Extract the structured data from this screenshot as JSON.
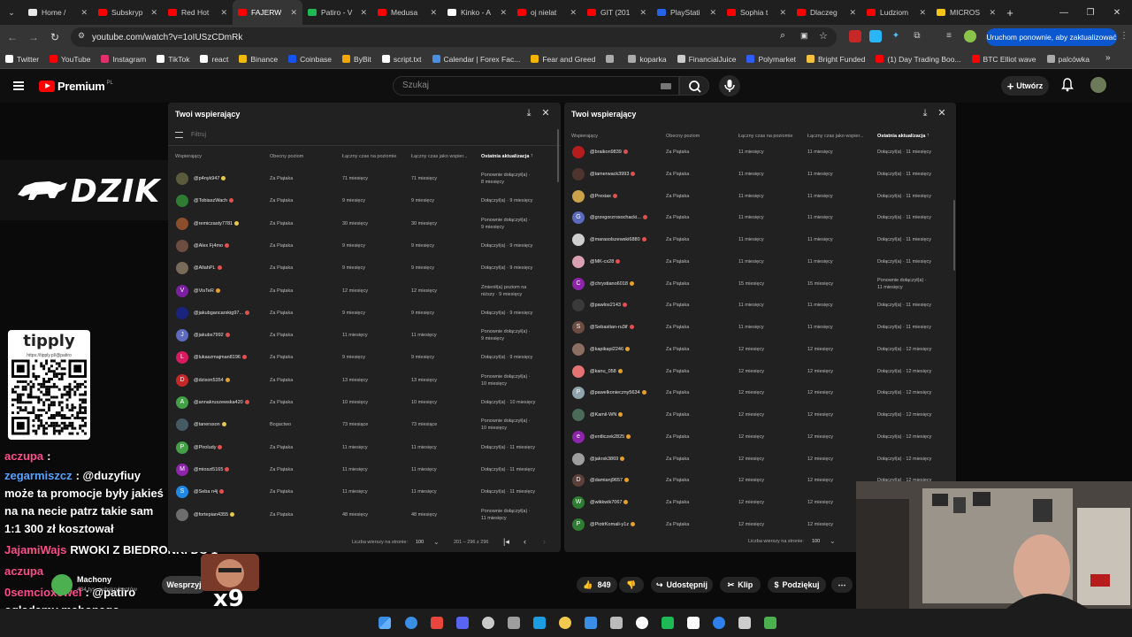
{
  "browser": {
    "tabs": [
      {
        "title": "Home /",
        "color": "#e8e8e8"
      },
      {
        "title": "Subskryp",
        "color": "#ff0000"
      },
      {
        "title": "Red Hot",
        "color": "#ff0000"
      },
      {
        "title": "FAJERW",
        "color": "#ff0000",
        "active": true
      },
      {
        "title": "Patiro - V",
        "color": "#1db954"
      },
      {
        "title": "Medusa",
        "color": "#ff0000"
      },
      {
        "title": "Kinko - A",
        "color": "#ffffff"
      },
      {
        "title": "oj nielat",
        "color": "#ff0000"
      },
      {
        "title": "GIT (201",
        "color": "#ff0000"
      },
      {
        "title": "PlayStati",
        "color": "#2563eb"
      },
      {
        "title": "Sophia t",
        "color": "#ff0000"
      },
      {
        "title": "Dlaczeg",
        "color": "#ff0000"
      },
      {
        "title": "Ludziom",
        "color": "#ff0000"
      },
      {
        "title": "MICROS",
        "color": "#f5c518"
      }
    ],
    "url": "youtube.com/watch?v=1oIUSzCDmRk",
    "update_label": "Uruchom ponownie, aby zaktualizować",
    "bookmarks": [
      {
        "label": "Twitter",
        "color": "#ffffff"
      },
      {
        "label": "YouTube",
        "color": "#ff0000"
      },
      {
        "label": "Instagram",
        "color": "#e1306c"
      },
      {
        "label": "TikTok",
        "color": "#ffffff"
      },
      {
        "label": "react",
        "color": "#ffffff"
      },
      {
        "label": "Binance",
        "color": "#f0b90b"
      },
      {
        "label": "Coinbase",
        "color": "#1652f0"
      },
      {
        "label": "ByBit",
        "color": "#f7a600"
      },
      {
        "label": "script.txt",
        "color": "#ffffff"
      },
      {
        "label": "Calendar | Forex Fac...",
        "color": "#4a90e2"
      },
      {
        "label": "Fear and Greed",
        "color": "#f4b400"
      },
      {
        "label": "",
        "color": "#aaaaaa"
      },
      {
        "label": "koparka",
        "color": "#aaaaaa"
      },
      {
        "label": "FinancialJuice",
        "color": "#cccccc"
      },
      {
        "label": "Polymarket",
        "color": "#2e5cff"
      },
      {
        "label": "Bright Funded",
        "color": "#f6c23e"
      },
      {
        "label": "(1) Day Trading Boo...",
        "color": "#ff0000"
      },
      {
        "label": "BTC Elliot wave",
        "color": "#ff0000"
      },
      {
        "label": "palcówka",
        "color": "#aaaaaa"
      }
    ]
  },
  "youtube": {
    "logo_text": "Premium",
    "logo_superscript": "PL",
    "search_placeholder": "Szukaj",
    "create_label": "Utwórz"
  },
  "video": {
    "brand": "DZIK",
    "tipply_title": "tipply",
    "tipply_url": "https://tipply.pl/@patiro",
    "chat": [
      {
        "user": "aczupa",
        "text": ":"
      },
      {
        "user": "zegarmiszcz",
        "text": ": @duzyfiuy"
      },
      {
        "user": "",
        "text": "może ta promocje były jakieś"
      },
      {
        "user": "",
        "text": "na na necie patrz takie sam"
      },
      {
        "user": "",
        "text": "1:1 300 zł kosztował"
      },
      {
        "user": "JajamiWajs",
        "text": "RWOKI Z BIEDRONKI DO 1"
      },
      {
        "user": "aczupa",
        "text": ""
      },
      {
        "user": "0semcioxcwel",
        "text": ": @patiro"
      },
      {
        "user": "",
        "text": "ogladamy mahonego"
      }
    ],
    "channel_name": "Machony",
    "channel_subs": "434 tys. subskrybentów",
    "support_label": "Wesprzyj",
    "meme_text": "x9",
    "likes": "849",
    "share_label": "Udostępnij",
    "clip_label": "Klip",
    "thanks_label": "Podziękuj"
  },
  "panel_left": {
    "title": "Twoi wspierający",
    "filter_placeholder": "Filtruj",
    "headers": [
      "Wspierający",
      "Obecny poziom",
      "Łączny czas na poziomie",
      "Łączny czas jako wspier...",
      "Ostatnia aktualizacja"
    ],
    "rows": [
      {
        "name": "@p4nyk947",
        "level": "Za Piątaka",
        "t1": "71 miesięcy",
        "t2": "71 miesięcy",
        "upd1": "Ponownie dołączył(a) ·",
        "upd2": "8 miesięcy",
        "av": "#5a5a3c",
        "badge": "#e6c84b"
      },
      {
        "name": "@TobiaszWach",
        "level": "Za Piątaka",
        "t1": "9 miesięcy",
        "t2": "9 miesięcy",
        "upd1": "Dołączył(a) · 9 miesięcy",
        "upd2": "",
        "av": "#2e7d32",
        "badge": "#e05050"
      },
      {
        "name": "@remiczasty7781",
        "level": "Za Piątaka",
        "t1": "30 miesięcy",
        "t2": "30 miesięcy",
        "upd1": "Ponownie dołączył(a) ·",
        "upd2": "9 miesięcy",
        "av": "#8d4f2b",
        "badge": "#e6c84b"
      },
      {
        "name": "@Alex Fj4mo",
        "level": "Za Piątaka",
        "t1": "9 miesięcy",
        "t2": "9 miesięcy",
        "upd1": "Dołączył(a) · 9 miesięcy",
        "upd2": "",
        "av": "#6d4c41",
        "badge": "#e05050"
      },
      {
        "name": "@AllahPL",
        "level": "Za Piątaka",
        "t1": "9 miesięcy",
        "t2": "9 miesięcy",
        "upd1": "Dołączył(a) · 9 miesięcy",
        "upd2": "",
        "av": "#7a6a5a",
        "badge": "#e05050"
      },
      {
        "name": "@VisTeR",
        "level": "Za Piątaka",
        "t1": "12 miesięcy",
        "t2": "12 miesięcy",
        "upd1": "Zmienił(a) poziom na",
        "upd2": "niższy · 9 miesięcy",
        "av": "#7b1fa2",
        "initial": "V",
        "badge": "#e6a02b"
      },
      {
        "name": "@jakubgancarskig97...",
        "level": "Za Piątaka",
        "t1": "9 miesięcy",
        "t2": "9 miesięcy",
        "upd1": "Dołączył(a) · 9 miesięcy",
        "upd2": "",
        "av": "#1a237e",
        "badge": "#e05050"
      },
      {
        "name": "@jakubs7992",
        "level": "Za Piątaka",
        "t1": "11 miesięcy",
        "t2": "11 miesięcy",
        "upd1": "Ponownie dołączył(a) ·",
        "upd2": "9 miesięcy",
        "av": "#5c6bc0",
        "initial": "J",
        "badge": "#e05050"
      },
      {
        "name": "@lukaszmajman8196",
        "level": "Za Piątaka",
        "t1": "9 miesięcy",
        "t2": "9 miesięcy",
        "upd1": "Dołączył(a) · 9 miesięcy",
        "upd2": "",
        "av": "#d81b60",
        "initial": "L",
        "badge": "#e05050"
      },
      {
        "name": "@dzixon5354",
        "level": "Za Piątaka",
        "t1": "13 miesięcy",
        "t2": "13 miesięcy",
        "upd1": "Ponownie dołączył(a) ·",
        "upd2": "10 miesięcy",
        "av": "#c62828",
        "initial": "D",
        "badge": "#e6a02b"
      },
      {
        "name": "@annakruszewska420",
        "level": "Za Piątaka",
        "t1": "10 miesięcy",
        "t2": "10 miesięcy",
        "upd1": "Dołączył(a) · 10 miesięcy",
        "upd2": "",
        "av": "#43a047",
        "initial": "A",
        "badge": "#e05050"
      },
      {
        "name": "@tanersson",
        "level": "Bogactwo",
        "t1": "73 miesiące",
        "t2": "73 miesiące",
        "upd1": "Ponownie dołączył(a) ·",
        "upd2": "10 miesięcy",
        "av": "#455a64",
        "badge": "#e6c84b"
      },
      {
        "name": "@Piroludy",
        "level": "Za Piątaka",
        "t1": "11 miesięcy",
        "t2": "11 miesięcy",
        "upd1": "Dołączył(a) · 11 miesięcy",
        "upd2": "",
        "av": "#43a047",
        "initial": "P",
        "badge": "#e05050"
      },
      {
        "name": "@mioszi5165",
        "level": "Za Piątaka",
        "t1": "11 miesięcy",
        "t2": "11 miesięcy",
        "upd1": "Dołączył(a) · 11 miesięcy",
        "upd2": "",
        "av": "#8e24aa",
        "initial": "M",
        "badge": "#e05050"
      },
      {
        "name": "@Seba n4j",
        "level": "Za Piątaka",
        "t1": "11 miesięcy",
        "t2": "11 miesięcy",
        "upd1": "Dołączył(a) · 11 miesięcy",
        "upd2": "",
        "av": "#1e88e5",
        "initial": "S",
        "badge": "#e05050"
      },
      {
        "name": "@fortepian4355",
        "level": "Za Piątaka",
        "t1": "48 miesięcy",
        "t2": "48 miesięcy",
        "upd1": "Ponownie dołączył(a) ·",
        "upd2": "11 miesięcy",
        "av": "#6d6d6d",
        "badge": "#e6c84b"
      }
    ],
    "rows_per_page_label": "Liczba wierszy na stronie:",
    "rows_per_page": "100",
    "range": "201 – 296 z 296"
  },
  "panel_right": {
    "title": "Twoi wspierający",
    "headers": [
      "Wspierający",
      "Obecny poziom",
      "Łączny czas na poziomie",
      "Łączny czas jako wspier...",
      "Ostatnia aktualizacja"
    ],
    "rows": [
      {
        "name": "@braikon9839",
        "level": "Za Piątaka",
        "t1": "11 miesięcy",
        "t2": "11 miesięcy",
        "upd1": "Dołączył(a) · 11 miesięcy",
        "upd2": "",
        "av": "#b71c1c",
        "badge": "#e05050"
      },
      {
        "name": "@tamerwack3993",
        "level": "Za Piątaka",
        "t1": "11 miesięcy",
        "t2": "11 miesięcy",
        "upd1": "Dołączył(a) · 11 miesięcy",
        "upd2": "",
        "av": "#4e342e",
        "badge": "#e05050"
      },
      {
        "name": "@Prexiax",
        "level": "Za Piątaka",
        "t1": "11 miesięcy",
        "t2": "11 miesięcy",
        "upd1": "Dołączył(a) · 11 miesięcy",
        "upd2": "",
        "av": "#c9a24a",
        "badge": "#e05050"
      },
      {
        "name": "@grzegorzrosochacki...",
        "level": "Za Piątaka",
        "t1": "11 miesięcy",
        "t2": "11 miesięcy",
        "upd1": "Dołączył(a) · 11 miesięcy",
        "upd2": "",
        "av": "#5c6bc0",
        "initial": "G",
        "badge": "#e05050"
      },
      {
        "name": "@marasolszewski6880",
        "level": "Za Piątaka",
        "t1": "11 miesięcy",
        "t2": "11 miesięcy",
        "upd1": "Dołączył(a) · 11 miesięcy",
        "upd2": "",
        "av": "#cfcfcf",
        "badge": "#e05050"
      },
      {
        "name": "@MK-cx28",
        "level": "Za Piątaka",
        "t1": "11 miesięcy",
        "t2": "11 miesięcy",
        "upd1": "Dołączył(a) · 11 miesięcy",
        "upd2": "",
        "av": "#d8a0b0",
        "badge": "#e05050"
      },
      {
        "name": "@chrystiano6018",
        "level": "Za Piątaka",
        "t1": "15 miesięcy",
        "t2": "15 miesięcy",
        "upd1": "Ponownie dołączył(a) ·",
        "upd2": "11 miesięcy",
        "av": "#8e24aa",
        "initial": "C",
        "badge": "#e6a02b"
      },
      {
        "name": "@pawlos2143",
        "level": "Za Piątaka",
        "t1": "11 miesięcy",
        "t2": "11 miesięcy",
        "upd1": "Dołączył(a) · 11 miesięcy",
        "upd2": "",
        "av": "#3a3a3a",
        "badge": "#e05050"
      },
      {
        "name": "@Sebastian-ru3if",
        "level": "Za Piątaka",
        "t1": "11 miesięcy",
        "t2": "11 miesięcy",
        "upd1": "Dołączył(a) · 11 miesięcy",
        "upd2": "",
        "av": "#6d4c41",
        "initial": "S",
        "badge": "#e05050"
      },
      {
        "name": "@kapikapi2246",
        "level": "Za Piątaka",
        "t1": "12 miesięcy",
        "t2": "12 miesięcy",
        "upd1": "Dołączył(a) · 12 miesięcy",
        "upd2": "",
        "av": "#8d6e63",
        "badge": "#e6a02b"
      },
      {
        "name": "@kanu_058",
        "level": "Za Piątaka",
        "t1": "12 miesięcy",
        "t2": "12 miesięcy",
        "upd1": "Dołączył(a) · 12 miesięcy",
        "upd2": "",
        "av": "#e57373",
        "badge": "#e6a02b"
      },
      {
        "name": "@pawelkonieczny5634",
        "level": "Za Piątaka",
        "t1": "12 miesięcy",
        "t2": "12 miesięcy",
        "upd1": "Dołączył(a) · 12 miesięcy",
        "upd2": "",
        "av": "#90a4ae",
        "initial": "P",
        "badge": "#e6a02b"
      },
      {
        "name": "@Kamil-WN",
        "level": "Za Piątaka",
        "t1": "12 miesięcy",
        "t2": "12 miesięcy",
        "upd1": "Dołączył(a) · 12 miesięcy",
        "upd2": "",
        "av": "#4a6a5a",
        "badge": "#e6a02b"
      },
      {
        "name": "@entliczek2825",
        "level": "Za Piątaka",
        "t1": "12 miesięcy",
        "t2": "12 miesięcy",
        "upd1": "Dołączył(a) · 12 miesięcy",
        "upd2": "",
        "av": "#8e24aa",
        "initial": "e",
        "badge": "#e6a02b"
      },
      {
        "name": "@jakrsk3869",
        "level": "Za Piątaka",
        "t1": "12 miesięcy",
        "t2": "12 miesięcy",
        "upd1": "Dołączył(a) · 12 miesięcy",
        "upd2": "",
        "av": "#9e9e9e",
        "badge": "#e6a02b"
      },
      {
        "name": "@damianj9657",
        "level": "Za Piątaka",
        "t1": "12 miesięcy",
        "t2": "12 miesięcy",
        "upd1": "Dołączył(a) · 12 miesięcy",
        "upd2": "",
        "av": "#5d4037",
        "initial": "D",
        "badge": "#e6a02b"
      },
      {
        "name": "@wikkwik7067",
        "level": "Za Piątaka",
        "t1": "12 miesięcy",
        "t2": "12 miesięcy",
        "upd1": "Dołączył(a) · 12 miesięcy",
        "upd2": "",
        "av": "#2e7d32",
        "initial": "W",
        "badge": "#e6a02b"
      },
      {
        "name": "@PiotrKomali-y1z",
        "level": "Za Piątaka",
        "t1": "12 miesięcy",
        "t2": "12 miesięcy",
        "upd1": "Dołączył(a) · 12 miesięcy",
        "upd2": "",
        "av": "#2e7d32",
        "initial": "P",
        "badge": "#e6a02b"
      }
    ],
    "rows_per_page_label": "Liczba wierszy na stronie:",
    "rows_per_page": "100"
  },
  "taskbar_icons": [
    "#3a8ee6",
    "#e8453c",
    "#5865f2",
    "#c9c9c9",
    "#9e9e9e",
    "#1b9de2",
    "#f2c94c",
    "#3a8ee6",
    "#bbbbbb",
    "#ffffff",
    "#1db954",
    "#ffffff",
    "#2f80ed",
    "#cccccc",
    "#4caf50"
  ]
}
